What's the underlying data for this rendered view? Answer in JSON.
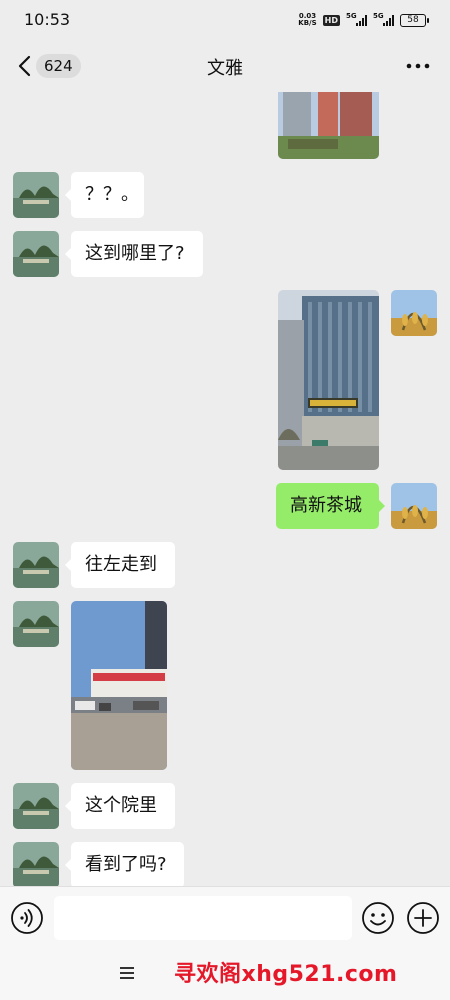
{
  "status_bar": {
    "time": "10:53",
    "net_speed_value": "0.03",
    "net_speed_unit": "KB/S",
    "hd_label": "HD",
    "sim1_label": "5G",
    "sim2_label": "5G",
    "battery_level": "58"
  },
  "header": {
    "back_count": "624",
    "title": "文雅"
  },
  "messages": [
    {
      "side": "in",
      "type": "text",
      "text": "？？。"
    },
    {
      "side": "in",
      "type": "text",
      "text": "这到哪里了?"
    },
    {
      "side": "out",
      "type": "image"
    },
    {
      "side": "out",
      "type": "text",
      "text": "高新茶城"
    },
    {
      "side": "in",
      "type": "text",
      "text": "往左走到"
    },
    {
      "side": "in",
      "type": "image"
    },
    {
      "side": "in",
      "type": "text",
      "text": "这个院里"
    },
    {
      "side": "in",
      "type": "text",
      "text": "看到了吗?"
    }
  ],
  "input": {
    "placeholder": ""
  },
  "watermark": "寻欢阁xhg521.com",
  "colors": {
    "background": "#ededed",
    "incoming_bubble": "#ffffff",
    "outgoing_bubble": "#95ec69",
    "watermark": "#e5182a"
  },
  "icons": [
    "back-arrow-icon",
    "more-dots-icon",
    "voice-icon",
    "emoji-icon",
    "plus-icon",
    "menu-icon"
  ]
}
